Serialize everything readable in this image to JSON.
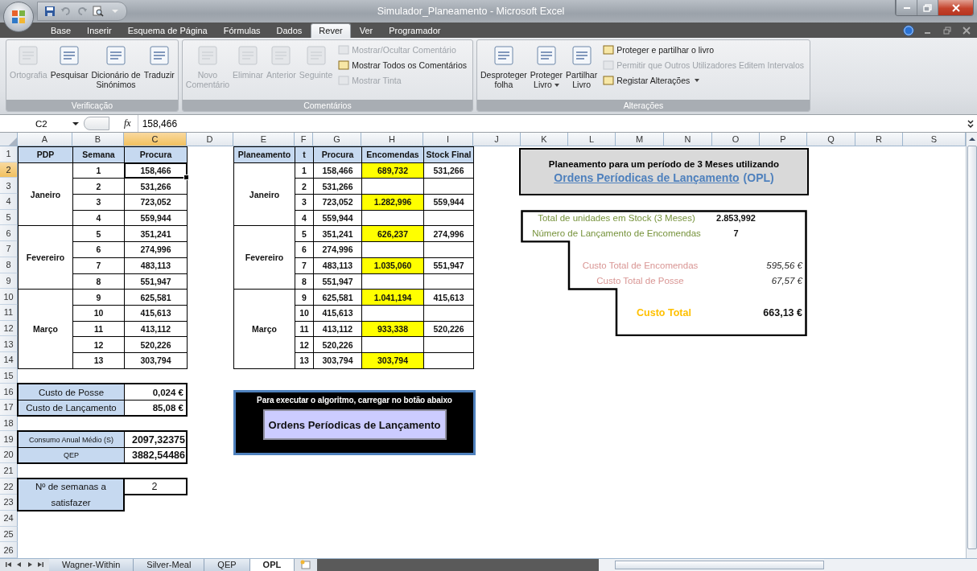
{
  "window": {
    "title": "Simulador_Planeamento - Microsoft Excel"
  },
  "ribbon_tabs": [
    {
      "label": "Base",
      "selected": false
    },
    {
      "label": "Inserir",
      "selected": false
    },
    {
      "label": "Esquema de Página",
      "selected": false
    },
    {
      "label": "Fórmulas",
      "selected": false
    },
    {
      "label": "Dados",
      "selected": false
    },
    {
      "label": "Rever",
      "selected": true
    },
    {
      "label": "Ver",
      "selected": false
    },
    {
      "label": "Programador",
      "selected": false
    }
  ],
  "ribbon_groups": [
    {
      "label": "Verificação",
      "items": [
        {
          "kind": "large",
          "label": "Ortografia",
          "disabled": true,
          "dropdown": false
        },
        {
          "kind": "large",
          "label": "Pesquisar",
          "disabled": false,
          "dropdown": false
        },
        {
          "kind": "large",
          "label": "Dicionário de\nSinónimos",
          "disabled": false,
          "dropdown": false
        },
        {
          "kind": "large",
          "label": "Traduzir",
          "disabled": false,
          "dropdown": false
        }
      ]
    },
    {
      "label": "Comentários",
      "items": [
        {
          "kind": "large",
          "label": "Novo\nComentário",
          "disabled": true,
          "dropdown": false
        },
        {
          "kind": "large",
          "label": "Eliminar",
          "disabled": true,
          "dropdown": false
        },
        {
          "kind": "large",
          "label": "Anterior",
          "disabled": true,
          "dropdown": false
        },
        {
          "kind": "large",
          "label": "Seguinte",
          "disabled": true,
          "dropdown": false
        },
        {
          "kind": "small",
          "label": "Mostrar/Ocultar Comentário",
          "disabled": true,
          "dropdown": false
        },
        {
          "kind": "small",
          "label": "Mostrar Todos os Comentários",
          "disabled": false,
          "dropdown": false
        },
        {
          "kind": "small",
          "label": "Mostrar Tinta",
          "disabled": true,
          "dropdown": false
        }
      ]
    },
    {
      "label": "Alterações",
      "items": [
        {
          "kind": "large",
          "label": "Desproteger\nfolha",
          "disabled": false,
          "dropdown": false
        },
        {
          "kind": "large",
          "label": "Proteger\nLivro",
          "disabled": false,
          "dropdown": true
        },
        {
          "kind": "large",
          "label": "Partilhar\nLivro",
          "disabled": false,
          "dropdown": false
        },
        {
          "kind": "small",
          "label": "Proteger e partilhar o livro",
          "disabled": false,
          "dropdown": false
        },
        {
          "kind": "small",
          "label": "Permitir que Outros Utilizadores Editem Intervalos",
          "disabled": true,
          "dropdown": false
        },
        {
          "kind": "small",
          "label": "Registar Alterações",
          "disabled": false,
          "dropdown": true
        }
      ]
    }
  ],
  "formula_bar": {
    "cell_ref": "C2",
    "function_label": "fx",
    "formula": "158,466"
  },
  "columns": [
    {
      "label": "A",
      "selected": false
    },
    {
      "label": "B",
      "selected": false
    },
    {
      "label": "C",
      "selected": true
    },
    {
      "label": "D",
      "selected": false
    },
    {
      "label": "E",
      "selected": false
    },
    {
      "label": "F",
      "selected": false
    },
    {
      "label": "G",
      "selected": false
    },
    {
      "label": "H",
      "selected": false
    },
    {
      "label": "I",
      "selected": false
    },
    {
      "label": "J",
      "selected": false
    },
    {
      "label": "K",
      "selected": false
    },
    {
      "label": "L",
      "selected": false
    },
    {
      "label": "M",
      "selected": false
    },
    {
      "label": "N",
      "selected": false
    },
    {
      "label": "O",
      "selected": false
    },
    {
      "label": "P",
      "selected": false
    },
    {
      "label": "Q",
      "selected": false
    },
    {
      "label": "R",
      "selected": false
    },
    {
      "label": "S",
      "selected": false
    }
  ],
  "rows": [
    {
      "label": "1",
      "selected": false
    },
    {
      "label": "2",
      "selected": true
    },
    {
      "label": "3",
      "selected": false
    },
    {
      "label": "4",
      "selected": false
    },
    {
      "label": "5",
      "selected": false
    },
    {
      "label": "6",
      "selected": false
    },
    {
      "label": "7",
      "selected": false
    },
    {
      "label": "8",
      "selected": false
    },
    {
      "label": "9",
      "selected": false
    },
    {
      "label": "10",
      "selected": false
    },
    {
      "label": "11",
      "selected": false
    },
    {
      "label": "12",
      "selected": false
    },
    {
      "label": "13",
      "selected": false
    },
    {
      "label": "14",
      "selected": false
    },
    {
      "label": "15",
      "selected": false
    },
    {
      "label": "16",
      "selected": false
    },
    {
      "label": "17",
      "selected": false
    },
    {
      "label": "18",
      "selected": false
    },
    {
      "label": "19",
      "selected": false
    },
    {
      "label": "20",
      "selected": false
    },
    {
      "label": "21",
      "selected": false
    },
    {
      "label": "22",
      "selected": false
    },
    {
      "label": "23",
      "selected": false
    },
    {
      "label": "24",
      "selected": false
    },
    {
      "label": "25",
      "selected": false
    },
    {
      "label": "26",
      "selected": false
    }
  ],
  "pdp_table": {
    "headers": [
      "PDP",
      "Semana",
      "Procura"
    ],
    "months": [
      {
        "name": "Janeiro",
        "weeks": [
          {
            "week": "1",
            "demand": "158,466",
            "active": true
          },
          {
            "week": "2",
            "demand": "531,266",
            "active": false
          },
          {
            "week": "3",
            "demand": "723,052",
            "active": false
          },
          {
            "week": "4",
            "demand": "559,944",
            "active": false
          }
        ]
      },
      {
        "name": "Fevereiro",
        "weeks": [
          {
            "week": "5",
            "demand": "351,241",
            "active": false
          },
          {
            "week": "6",
            "demand": "274,996",
            "active": false
          },
          {
            "week": "7",
            "demand": "483,113",
            "active": false
          },
          {
            "week": "8",
            "demand": "551,947",
            "active": false
          }
        ]
      },
      {
        "name": "Março",
        "weeks": [
          {
            "week": "9",
            "demand": "625,581",
            "active": false
          },
          {
            "week": "10",
            "demand": "415,613",
            "active": false
          },
          {
            "week": "11",
            "demand": "413,112",
            "active": false
          },
          {
            "week": "12",
            "demand": "520,226",
            "active": false
          },
          {
            "week": "13",
            "demand": "303,794",
            "active": false
          }
        ]
      }
    ]
  },
  "plan_table": {
    "headers": [
      "Planeamento",
      "t",
      "Procura",
      "Encomendas",
      "Stock Final"
    ],
    "months": [
      {
        "name": "Janeiro",
        "rows": [
          {
            "t": "1",
            "demand": "158,466",
            "order": "689,732",
            "stock": "531,266"
          },
          {
            "t": "2",
            "demand": "531,266"
          },
          {
            "t": "3",
            "demand": "723,052",
            "order": "1.282,996",
            "stock": "559,944"
          },
          {
            "t": "4",
            "demand": "559,944"
          }
        ]
      },
      {
        "name": "Fevereiro",
        "rows": [
          {
            "t": "5",
            "demand": "351,241",
            "order": "626,237",
            "stock": "274,996"
          },
          {
            "t": "6",
            "demand": "274,996"
          },
          {
            "t": "7",
            "demand": "483,113",
            "order": "1.035,060",
            "stock": "551,947"
          },
          {
            "t": "8",
            "demand": "551,947"
          }
        ]
      },
      {
        "name": "Março",
        "rows": [
          {
            "t": "9",
            "demand": "625,581",
            "order": "1.041,194",
            "stock": "415,613"
          },
          {
            "t": "10",
            "demand": "415,613"
          },
          {
            "t": "11",
            "demand": "413,112",
            "order": "933,338",
            "stock": "520,226"
          },
          {
            "t": "12",
            "demand": "520,226"
          },
          {
            "t": "13",
            "demand": "303,794",
            "order": "303,794"
          }
        ]
      }
    ]
  },
  "costs": [
    {
      "label": "Custo de Posse",
      "value": "0,024 €"
    },
    {
      "label": "Custo de Lançamento",
      "value": "85,08 €"
    }
  ],
  "demand_stats": [
    {
      "label": "Consumo Anual Médio (S)",
      "value": "2097,32375"
    },
    {
      "label": "QEP",
      "value": "3882,54486"
    }
  ],
  "weeks_setting": {
    "label": "Nº de semanas a satisfazer",
    "value": "2"
  },
  "run_panel": {
    "caption": "Para executar o algoritmo, carregar no botão abaixo",
    "button": "Ordens Períodicas de Lançamento"
  },
  "summary_title": {
    "heading": "Planeamento para um período de 3 Meses utilizando",
    "link": "Ordens Períodicas de Lançamento",
    "suffix": "(OPL)"
  },
  "summary": [
    {
      "kind": "count",
      "label": "Total de unidades em Stock (3 Meses)",
      "value": "2.853,992"
    },
    {
      "kind": "count",
      "label": "Número de Lançamento de Encomendas",
      "value": "7"
    },
    {
      "kind": "cost",
      "label": "Custo Total de Encomendas",
      "value": "595,56 €"
    },
    {
      "kind": "cost",
      "label": "Custo Total de Posse",
      "value": "67,57 €"
    },
    {
      "kind": "total",
      "label": "Custo Total",
      "value": "663,13 €"
    }
  ],
  "sheet_tabs": [
    {
      "label": "Wagner-Within",
      "selected": false
    },
    {
      "label": "Silver-Meal",
      "selected": false
    },
    {
      "label": "QEP",
      "selected": false
    },
    {
      "label": "OPL",
      "selected": true
    }
  ]
}
